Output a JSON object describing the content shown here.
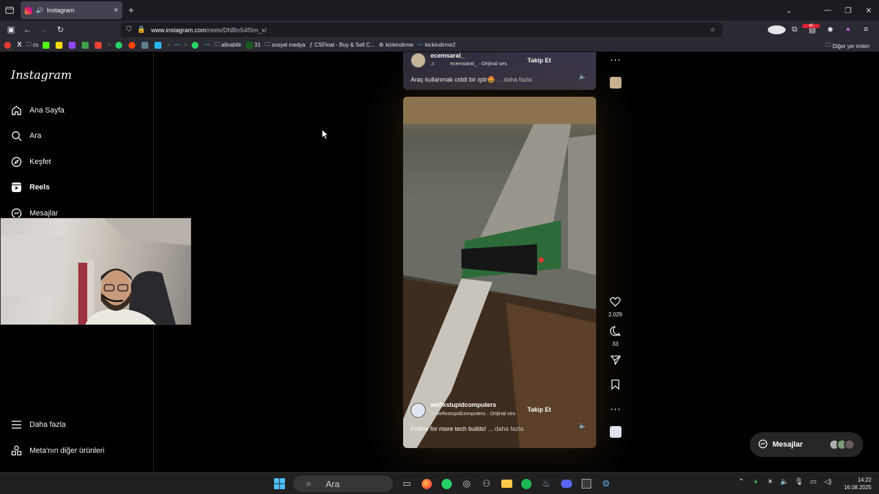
{
  "browser": {
    "tab_title": "Instagram",
    "url_host": "www.instagram.com",
    "url_path": "/reels/DNBnS4fSm_x/",
    "tab_close": "×",
    "new_tab": "+",
    "ext_badge_count": "40",
    "ext_badge_letter": "V",
    "bookmarks": [
      {
        "label": "cs",
        "icon": "folder-icon"
      },
      {
        "label": "alinabilir",
        "icon": "folder-icon"
      },
      {
        "label": "31",
        "icon": "sheet-icon"
      },
      {
        "label": "sosyal medya",
        "icon": "folder-icon"
      },
      {
        "label": "CSFloat - Buy & Sell C...",
        "icon": "csfloat-icon"
      },
      {
        "label": "kickindirme",
        "icon": "kick-icon"
      },
      {
        "label": "kickindirme2",
        "icon": "kick-icon"
      }
    ],
    "other_bookmarks": "Diğer yer imleri"
  },
  "instagram": {
    "logo": "Instagram",
    "nav": [
      {
        "label": "Ana Sayfa",
        "icon": "home-icon"
      },
      {
        "label": "Ara",
        "icon": "search-icon"
      },
      {
        "label": "Keşfet",
        "icon": "compass-icon"
      },
      {
        "label": "Reels",
        "icon": "reels-icon"
      },
      {
        "label": "Mesajlar",
        "icon": "messenger-icon"
      }
    ],
    "nav_bottom": [
      {
        "label": "Daha fazla",
        "icon": "menu-icon"
      },
      {
        "label": "Meta'nın diğer ürünleri",
        "icon": "meta-icon"
      }
    ],
    "reel_prev": {
      "username": "ecemsaral_",
      "audio": "ecemsaral_ · Orijinal ses",
      "follow": "Takip Et",
      "caption": "Araç kullanmak ciddi bir iştir🤩",
      "more": "... daha fazla"
    },
    "reel_current": {
      "username": "wefixstupidcomputers",
      "audio": "wefixstupidcomputers · Orijinal ses",
      "follow": "Takip Et",
      "caption": "Follow for more tech builds!",
      "more": "... daha fazla",
      "likes": "2.029",
      "comments": "33"
    },
    "messages_pill": "Mesajlar"
  },
  "taskbar": {
    "search_placeholder": "Ara",
    "time": "14:22",
    "date": "16.08.2025"
  }
}
